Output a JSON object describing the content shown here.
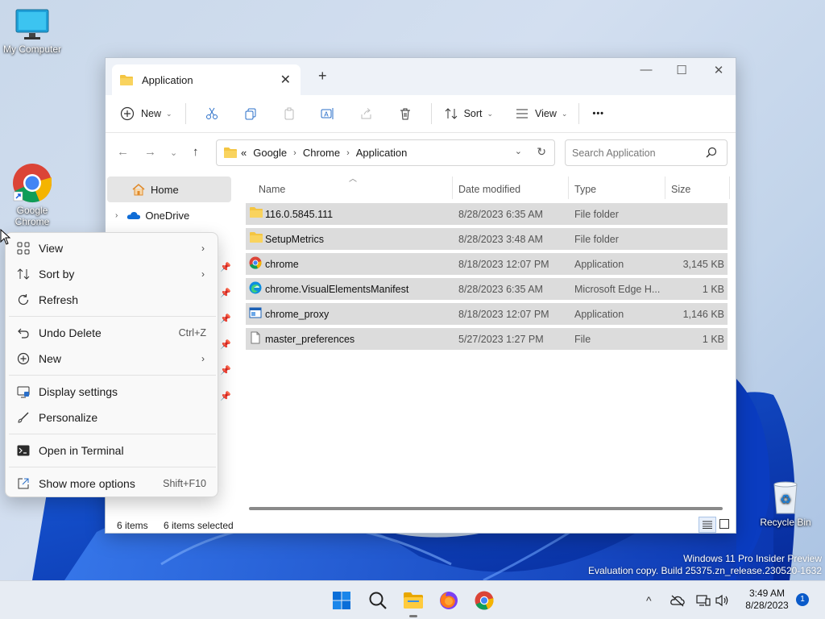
{
  "desktop": {
    "icons": [
      {
        "label": "My Computer"
      },
      {
        "label": "Google Chrome"
      },
      {
        "label": "Recycle Bin"
      }
    ],
    "watermark": {
      "line1": "Windows 11 Pro Insider Preview",
      "line2": "Evaluation copy. Build 25375.zn_release.230520-1632"
    }
  },
  "window": {
    "tab_title": "Application",
    "tab_close": "✕",
    "new_tab": "+",
    "controls": {
      "minimize": "—",
      "maximize": "☐",
      "close": "✕"
    },
    "toolbar": {
      "new_label": "New",
      "sort_label": "Sort",
      "view_label": "View",
      "more_label": "•••"
    },
    "address": {
      "overflow": "«",
      "crumbs": [
        "Google",
        "Chrome",
        "Application"
      ]
    },
    "search": {
      "placeholder": "Search Application"
    },
    "nav": {
      "home": "Home",
      "onedrive": "OneDrive"
    },
    "columns": {
      "name": "Name",
      "date": "Date modified",
      "type": "Type",
      "size": "Size"
    },
    "files": [
      {
        "name": "116.0.5845.111",
        "date": "8/28/2023 6:35 AM",
        "type": "File folder",
        "size": "",
        "icon": "folder-icon"
      },
      {
        "name": "SetupMetrics",
        "date": "8/28/2023 3:48 AM",
        "type": "File folder",
        "size": "",
        "icon": "folder-icon"
      },
      {
        "name": "chrome",
        "date": "8/18/2023 12:07 PM",
        "type": "Application",
        "size": "3,145 KB",
        "icon": "chrome-icon"
      },
      {
        "name": "chrome.VisualElementsManifest",
        "date": "8/28/2023 6:35 AM",
        "type": "Microsoft Edge H...",
        "size": "1 KB",
        "icon": "edge-icon"
      },
      {
        "name": "chrome_proxy",
        "date": "8/18/2023 12:07 PM",
        "type": "Application",
        "size": "1,146 KB",
        "icon": "exe-icon"
      },
      {
        "name": "master_preferences",
        "date": "5/27/2023 1:27 PM",
        "type": "File",
        "size": "1 KB",
        "icon": "file-icon"
      }
    ],
    "status": {
      "count": "6 items",
      "selected": "6 items selected"
    }
  },
  "context_menu": {
    "items": [
      {
        "label": "View",
        "shortcut": "",
        "submenu": true,
        "icon": "grid-icon"
      },
      {
        "label": "Sort by",
        "shortcut": "",
        "submenu": true,
        "icon": "sort-icon"
      },
      {
        "label": "Refresh",
        "shortcut": "",
        "submenu": false,
        "icon": "refresh-icon"
      },
      {
        "label": "Undo Delete",
        "shortcut": "Ctrl+Z",
        "submenu": false,
        "icon": "undo-icon"
      },
      {
        "label": "New",
        "shortcut": "",
        "submenu": true,
        "icon": "plus-circle-icon"
      },
      {
        "label": "Display settings",
        "shortcut": "",
        "submenu": false,
        "icon": "display-icon"
      },
      {
        "label": "Personalize",
        "shortcut": "",
        "submenu": false,
        "icon": "brush-icon"
      },
      {
        "label": "Open in Terminal",
        "shortcut": "",
        "submenu": false,
        "icon": "terminal-icon"
      },
      {
        "label": "Show more options",
        "shortcut": "Shift+F10",
        "submenu": false,
        "icon": "share-icon"
      }
    ],
    "arrow": "›"
  },
  "taskbar": {
    "time": "3:49 AM",
    "date": "8/28/2023",
    "notifications": "1",
    "tray_chevron": "^"
  },
  "colors": {
    "accent": "#0a5ac9",
    "folder": "#f4c542",
    "selection": "#dcdcdc"
  }
}
